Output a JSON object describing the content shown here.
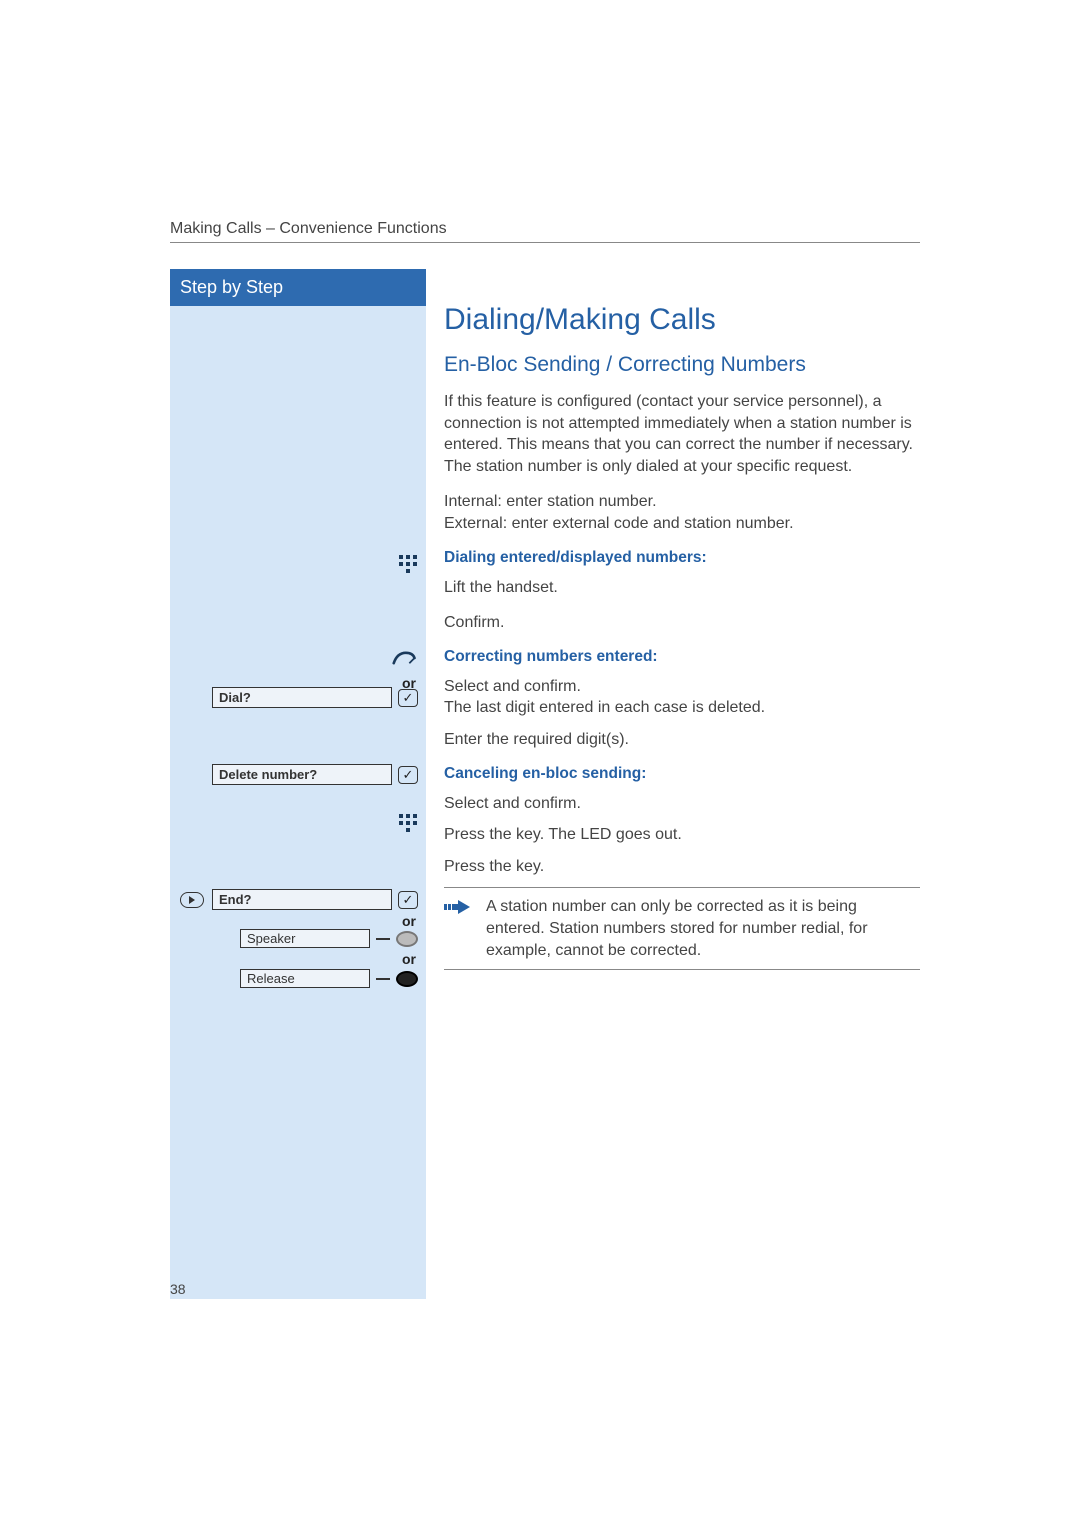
{
  "header": "Making Calls – Convenience Functions",
  "sidebar": {
    "title": "Step by Step",
    "dial_label": "Dial?",
    "delete_label": "Delete number?",
    "end_label": "End?",
    "speaker_label": "Speaker",
    "release_label": "Release",
    "or": "or"
  },
  "main": {
    "h1": "Dialing/Making Calls",
    "h2": "En-Bloc Sending / Correcting Numbers",
    "intro": "If this feature is configured (contact your service personnel), a connection is not attempted immediately when a station number is entered. This means that you can correct the number if necessary.\nThe station number is only dialed at your specific request.",
    "internal_external": "Internal: enter station number.\nExternal: enter external code and station number.",
    "sub1": "Dialing entered/displayed numbers:",
    "lift": "Lift the handset.",
    "confirm": "Confirm.",
    "sub2": "Correcting numbers entered:",
    "select_confirm": "Select and confirm.\nThe last digit entered in each case is deleted.",
    "enter_digits": "Enter the required digit(s).",
    "sub3": "Canceling en-bloc sending:",
    "select_confirm2": "Select and confirm.",
    "press_led": "Press the key. The LED goes out.",
    "press_key": "Press the key.",
    "note": "A station number can only be corrected as it is being entered. Station numbers stored for number redial, for example, cannot be corrected."
  },
  "page_number": "38"
}
